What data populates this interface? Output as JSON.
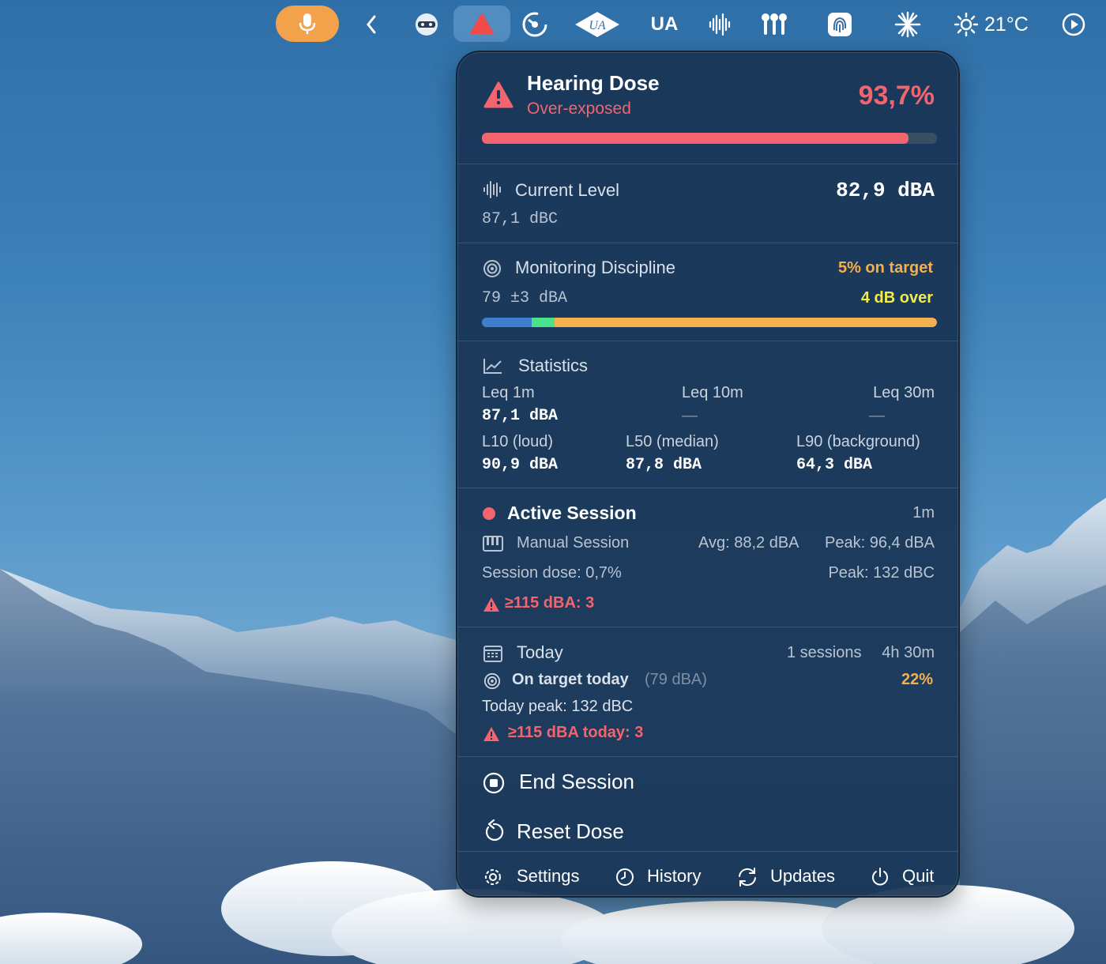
{
  "menubar": {
    "items": [
      {
        "icon": "microphone-icon"
      },
      {
        "icon": "chevron-left-icon"
      },
      {
        "icon": "face-icon"
      },
      {
        "icon": "warning-triangle-icon"
      },
      {
        "icon": "gauge-icon"
      },
      {
        "icon": "ua-logo-icon"
      },
      {
        "icon": "ua-text-icon",
        "text": "UA"
      },
      {
        "icon": "waveform-icon"
      },
      {
        "icon": "airpods-icon"
      },
      {
        "icon": "fingerprint-icon"
      },
      {
        "icon": "sparkle-icon"
      },
      {
        "icon": "weather-sun-icon",
        "text": "21°C"
      },
      {
        "icon": "play-circle-icon"
      }
    ]
  },
  "popup": {
    "header": {
      "title": "Hearing Dose",
      "status": "Over-exposed",
      "percent": "93,7%",
      "dose_fraction": 0.937
    },
    "current_level": {
      "label": "Current Level",
      "value": "82,9 dBA",
      "secondary": "87,1 dBC"
    },
    "monitoring": {
      "label": "Monitoring Discipline",
      "on_target": "5% on target",
      "target": "79 ±3 dBA",
      "over": "4 dB over",
      "segments": {
        "under": 0.11,
        "on": 0.05,
        "over": 0.84
      }
    },
    "statistics": {
      "label": "Statistics",
      "leq_1m_label": "Leq 1m",
      "leq_1m_value": "87,1 dBA",
      "leq_10m_label": "Leq 10m",
      "leq_10m_value": "—",
      "leq_30m_label": "Leq 30m",
      "leq_30m_value": "—",
      "l10_label": "L10 (loud)",
      "l10_value": "90,9 dBA",
      "l50_label": "L50 (median)",
      "l50_value": "87,8 dBA",
      "l90_label": "L90 (background)",
      "l90_value": "64,3 dBA"
    },
    "active_session": {
      "label": "Active Session",
      "duration": "1m",
      "type": "Manual Session",
      "avg": "Avg: 88,2 dBA",
      "peak": "Peak: 96,4 dBA",
      "session_dose": "Session dose: 0,7%",
      "peak_c": "Peak: 132 dBC",
      "warning": "≥115 dBA: 3"
    },
    "today": {
      "label": "Today",
      "sessions": "1 sessions",
      "time": "4h 30m",
      "on_target_label": "On target today",
      "on_target_ref": "(79 dBA)",
      "on_target_pct": "22%",
      "peak": "Today peak: 132 dBC",
      "warning": "≥115 dBA today: 3"
    },
    "actions": {
      "end_session": "End Session",
      "reset_dose": "Reset Dose"
    },
    "footer": {
      "settings": "Settings",
      "history": "History",
      "updates": "Updates",
      "quit": "Quit"
    }
  },
  "colors": {
    "accent_red": "#f4646f",
    "accent_orange": "#f4b04f",
    "accent_yellow": "#f2ec4f",
    "under_blue": "#3f7fd0",
    "on_green": "#4ae38a",
    "mic_orange": "#f2a24a"
  }
}
